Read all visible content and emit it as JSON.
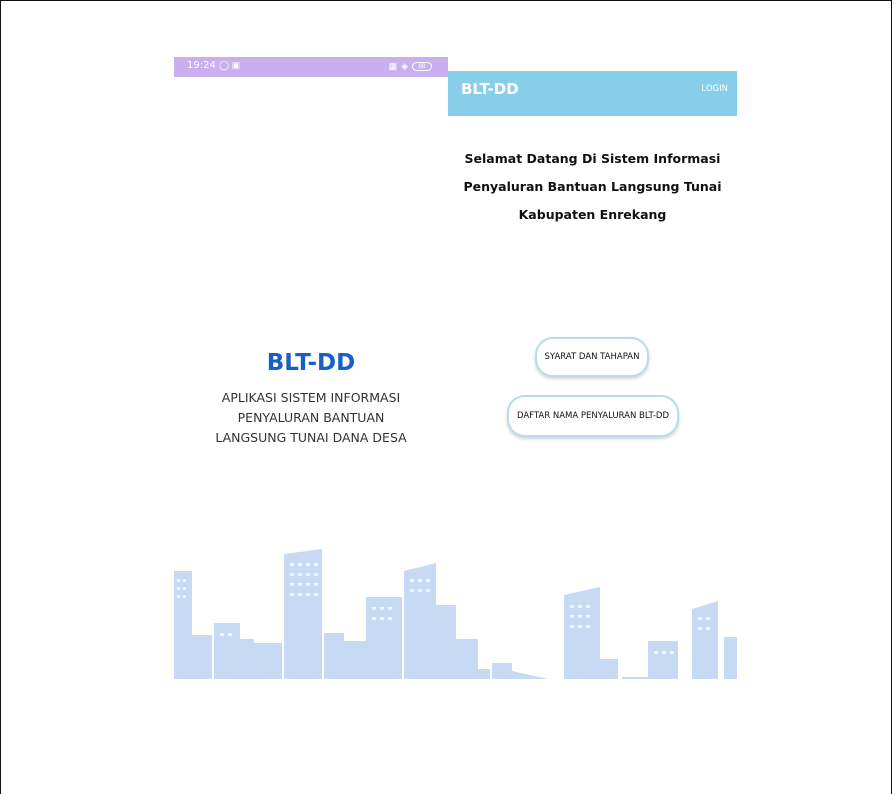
{
  "left_screen": {
    "status_bar": {
      "time": "19:24",
      "status_icons": [
        "whatsapp-icon",
        "calendar-icon"
      ],
      "right_icons": [
        "signal-icon",
        "wifi-icon",
        "battery-icon"
      ],
      "battery_level": "88"
    },
    "app_name": "BLT-DD",
    "subtitle_lines": [
      "APLIKASI SISTEM INFORMASI",
      "PENYALURAN BANTUAN",
      "LANGSUNG TUNAI DANA DESA"
    ]
  },
  "right_screen": {
    "appbar": {
      "title": "BLT-DD",
      "login_label": "LOGIN"
    },
    "welcome_lines": [
      "Selamat Datang Di Sistem Informasi",
      "Penyaluran Bantuan Langsung Tunai",
      "Kabupaten Enrekang"
    ],
    "buttons": [
      {
        "label": "SYARAT DAN TAHAPAN"
      },
      {
        "label": "DAFTAR NAMA PENYALURAN BLT-DD"
      }
    ]
  },
  "colors": {
    "status_bar": "#c8b0ee",
    "appbar": "#87ceeb",
    "brand_blue": "#1660c6",
    "skyline": "#c6daf3"
  }
}
